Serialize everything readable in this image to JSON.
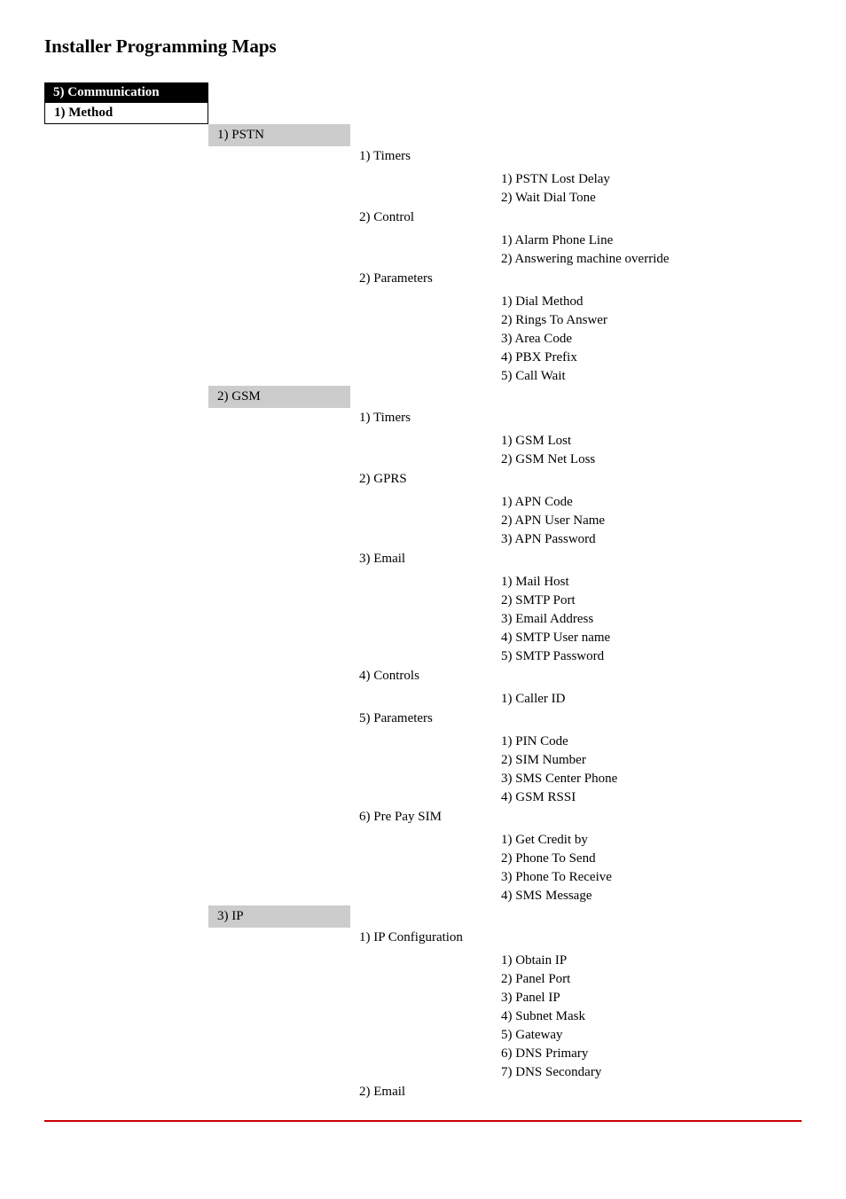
{
  "title": "Installer Programming Maps",
  "header1": "5) Communication",
  "header2": "1) Method",
  "sections": {
    "pstn": {
      "label": "1) PSTN",
      "sub": {
        "timers": {
          "label": "1) Timers",
          "items": [
            "1) PSTN Lost Delay",
            "2) Wait Dial Tone"
          ]
        },
        "control": {
          "label": "2) Control",
          "items": [
            "1) Alarm Phone Line",
            "2) Answering machine override"
          ]
        },
        "parameters": {
          "label": "2) Parameters",
          "items": [
            "1) Dial Method",
            "2) Rings To Answer",
            "3) Area Code",
            "4) PBX Prefix",
            "5) Call Wait"
          ]
        }
      }
    },
    "gsm": {
      "label": "2) GSM",
      "sub": {
        "timers": {
          "label": "1) Timers",
          "items": [
            "1) GSM Lost",
            "2) GSM Net Loss"
          ]
        },
        "gprs": {
          "label": "2) GPRS",
          "items": [
            "1) APN Code",
            "2) APN User Name",
            "3) APN Password"
          ]
        },
        "email": {
          "label": "3) Email",
          "items": [
            "1) Mail Host",
            "2) SMTP Port",
            "3) Email Address",
            "4) SMTP User name",
            "5) SMTP Password"
          ]
        },
        "controls": {
          "label": "4) Controls",
          "items": [
            "1) Caller ID"
          ]
        },
        "parameters": {
          "label": "5) Parameters",
          "items": [
            "1) PIN Code",
            "2) SIM Number",
            "3) SMS Center Phone",
            "4) GSM RSSI"
          ]
        },
        "prepay": {
          "label": "6) Pre Pay SIM",
          "items": [
            "1) Get Credit by",
            "2) Phone To Send",
            "3) Phone To Receive",
            "4) SMS Message"
          ]
        }
      }
    },
    "ip": {
      "label": "3) IP",
      "sub": {
        "ipconfig": {
          "label": "1) IP Configuration",
          "items": [
            "1) Obtain IP",
            "2) Panel Port",
            "3) Panel IP",
            "4) Subnet Mask",
            "5) Gateway",
            "6) DNS Primary",
            "7) DNS Secondary"
          ]
        },
        "email": {
          "label": "2) Email",
          "items": []
        }
      }
    }
  }
}
